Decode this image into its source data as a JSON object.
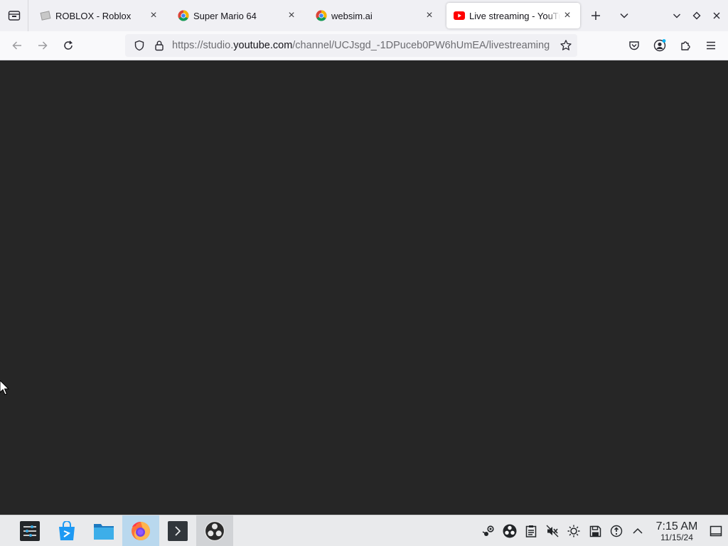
{
  "browser": {
    "tabs": [
      {
        "title": "ROBLOX - Roblox",
        "favicon": "roblox-icon",
        "active": false
      },
      {
        "title": "Super Mario 64",
        "favicon": "chrome-icon",
        "active": false
      },
      {
        "title": "websim.ai",
        "favicon": "chrome-icon",
        "active": false
      },
      {
        "title": "Live streaming - YouTube Studio",
        "favicon": "youtube-icon",
        "active": true
      }
    ],
    "url": {
      "prefix": "https://studio.",
      "host": "youtube.com",
      "path": "/channel/UCJsgd_-1DPuceb0PW6hUmEA/livestreaming"
    }
  },
  "taskbar": {
    "apps": [
      {
        "name": "app-launcher",
        "state": "normal"
      },
      {
        "name": "discover-store",
        "state": "normal"
      },
      {
        "name": "file-manager",
        "state": "normal"
      },
      {
        "name": "firefox",
        "state": "active"
      },
      {
        "name": "terminal",
        "state": "normal"
      },
      {
        "name": "obs-studio",
        "state": "open"
      }
    ],
    "clock": {
      "time": "7:15 AM",
      "date": "11/15/24"
    }
  },
  "colors": {
    "content_bg": "#262626",
    "taskbar_active": "#b9d8ee",
    "youtube_red": "#ff0000",
    "firefox_orange": "#ff7139"
  }
}
